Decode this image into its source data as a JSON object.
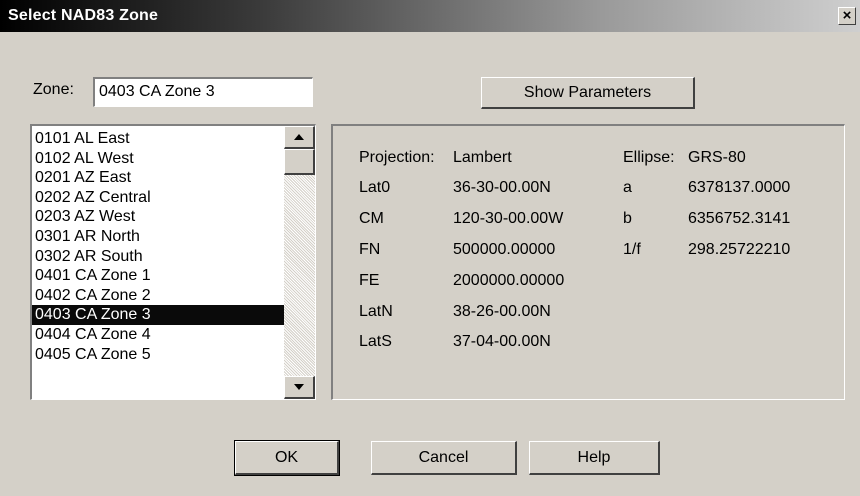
{
  "window": {
    "title": "Select NAD83 Zone",
    "close_glyph": "×"
  },
  "zone": {
    "label": "Zone:",
    "value": "0403 CA Zone 3"
  },
  "buttons": {
    "show_parameters": "Show Parameters",
    "ok": "OK",
    "cancel": "Cancel",
    "help": "Help"
  },
  "zone_list": {
    "items": [
      "0101 AL East",
      "0102 AL West",
      "0201 AZ East",
      "0202 AZ Central",
      "0203 AZ West",
      "0301 AR North",
      "0302 AR South",
      "0401 CA Zone 1",
      "0402 CA Zone 2",
      "0403 CA Zone 3",
      "0404 CA Zone 4",
      "0405 CA Zone 5"
    ],
    "selected_index": 9,
    "selected_color": "#0a0a0a"
  },
  "parameters": {
    "projection_label": "Projection:",
    "projection_value": "Lambert",
    "lat0_label": "Lat0",
    "lat0_value": "36-30-00.00N",
    "cm_label": "CM",
    "cm_value": "120-30-00.00W",
    "fn_label": "FN",
    "fn_value": "500000.00000",
    "fe_label": "FE",
    "fe_value": "2000000.00000",
    "latn_label": "LatN",
    "latn_value": "38-26-00.00N",
    "lats_label": "LatS",
    "lats_value": "37-04-00.00N",
    "ellipse_label": "Ellipse:",
    "ellipse_value": "GRS-80",
    "a_label": "a",
    "a_value": "6378137.0000",
    "b_label": "b",
    "b_value": "6356752.3141",
    "f_label": "1/f",
    "f_value": "298.25722210"
  }
}
